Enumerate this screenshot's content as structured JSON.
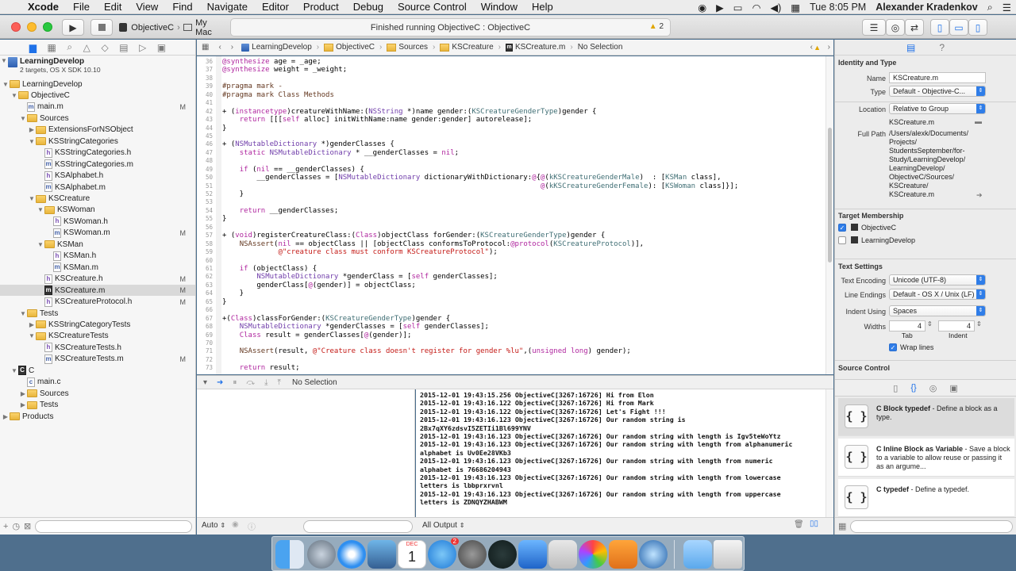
{
  "menubar": {
    "app": "Xcode",
    "items": [
      "File",
      "Edit",
      "View",
      "Find",
      "Navigate",
      "Editor",
      "Product",
      "Debug",
      "Source Control",
      "Window",
      "Help"
    ],
    "clock": "Tue 8:05 PM",
    "user": "Alexander Kradenkov"
  },
  "toolbar": {
    "scheme": "ObjectiveC",
    "destination": "My Mac",
    "activity": "Finished running ObjectiveC : ObjectiveC",
    "warnings": "2"
  },
  "navigator": {
    "project_name": "LearningDevelop",
    "project_sub": "2 targets, OS X SDK 10.10",
    "rows": [
      {
        "label": "LearningDevelop",
        "kind": "folder",
        "open": true,
        "indent": 1,
        "flag": ""
      },
      {
        "label": "ObjectiveC",
        "kind": "folder",
        "open": true,
        "indent": 2,
        "flag": ""
      },
      {
        "label": "main.m",
        "kind": "m",
        "open": null,
        "indent": 3,
        "flag": "M"
      },
      {
        "label": "Sources",
        "kind": "folder",
        "open": true,
        "indent": 3,
        "flag": ""
      },
      {
        "label": "ExtensionsForNSObject",
        "kind": "folder",
        "open": false,
        "indent": 4,
        "flag": ""
      },
      {
        "label": "KSStringCategories",
        "kind": "folder",
        "open": true,
        "indent": 4,
        "flag": ""
      },
      {
        "label": "KSStringCategories.h",
        "kind": "h",
        "open": null,
        "indent": 5,
        "flag": ""
      },
      {
        "label": "KSStringCategories.m",
        "kind": "m",
        "open": null,
        "indent": 5,
        "flag": ""
      },
      {
        "label": "KSAlphabet.h",
        "kind": "h",
        "open": null,
        "indent": 5,
        "flag": ""
      },
      {
        "label": "KSAlphabet.m",
        "kind": "m",
        "open": null,
        "indent": 5,
        "flag": ""
      },
      {
        "label": "KSCreature",
        "kind": "folder",
        "open": true,
        "indent": 4,
        "flag": ""
      },
      {
        "label": "KSWoman",
        "kind": "folder",
        "open": true,
        "indent": 5,
        "flag": ""
      },
      {
        "label": "KSWoman.h",
        "kind": "h",
        "open": null,
        "indent": 6,
        "flag": ""
      },
      {
        "label": "KSWoman.m",
        "kind": "m",
        "open": null,
        "indent": 6,
        "flag": "M"
      },
      {
        "label": "KSMan",
        "kind": "folder",
        "open": true,
        "indent": 5,
        "flag": ""
      },
      {
        "label": "KSMan.h",
        "kind": "h",
        "open": null,
        "indent": 6,
        "flag": ""
      },
      {
        "label": "KSMan.m",
        "kind": "m",
        "open": null,
        "indent": 6,
        "flag": ""
      },
      {
        "label": "KSCreature.h",
        "kind": "h",
        "open": null,
        "indent": 5,
        "flag": "M"
      },
      {
        "label": "KSCreature.m",
        "kind": "mdark",
        "open": null,
        "indent": 5,
        "flag": "M",
        "selected": true
      },
      {
        "label": "KSCreatureProtocol.h",
        "kind": "h",
        "open": null,
        "indent": 5,
        "flag": "M"
      },
      {
        "label": "Tests",
        "kind": "folder",
        "open": true,
        "indent": 3,
        "flag": ""
      },
      {
        "label": "KSStringCategoryTests",
        "kind": "folder",
        "open": false,
        "indent": 4,
        "flag": ""
      },
      {
        "label": "KSCreatureTests",
        "kind": "folder",
        "open": true,
        "indent": 4,
        "flag": ""
      },
      {
        "label": "KSCreatureTests.h",
        "kind": "h",
        "open": null,
        "indent": 5,
        "flag": ""
      },
      {
        "label": "KSCreatureTests.m",
        "kind": "m",
        "open": null,
        "indent": 5,
        "flag": "M"
      },
      {
        "label": "C",
        "kind": "cfolder",
        "open": true,
        "indent": 2,
        "flag": ""
      },
      {
        "label": "main.c",
        "kind": "c",
        "open": null,
        "indent": 3,
        "flag": ""
      },
      {
        "label": "Sources",
        "kind": "folder",
        "open": false,
        "indent": 3,
        "flag": ""
      },
      {
        "label": "Tests",
        "kind": "folder",
        "open": false,
        "indent": 3,
        "flag": ""
      },
      {
        "label": "Products",
        "kind": "folder",
        "open": false,
        "indent": 1,
        "flag": ""
      }
    ]
  },
  "jumpbar": {
    "crumbs": [
      "LearningDevelop",
      "ObjectiveC",
      "Sources",
      "KSCreature",
      "KSCreature.m",
      "No Selection"
    ]
  },
  "editor": {
    "lines": [
      {
        "n": "36",
        "h": "<span class=\"kw\">@synthesize</span> age = _age;"
      },
      {
        "n": "37",
        "h": "<span class=\"kw\">@synthesize</span> weight = _weight;"
      },
      {
        "n": "38",
        "h": ""
      },
      {
        "n": "39",
        "h": "<span class=\"mac\">#pragma mark -</span>"
      },
      {
        "n": "40",
        "h": "<span class=\"mac\">#pragma mark Class Methods</span>"
      },
      {
        "n": "41",
        "h": ""
      },
      {
        "n": "42",
        "h": "+ (<span class=\"kw\">instancetype</span>)creatureWithName:(<span class=\"ty\">NSString</span> *)name gender:(<span class=\"pr\">KSCreatureGenderType</span>)gender {"
      },
      {
        "n": "43",
        "h": "    <span class=\"kw\">return</span> [[[<span class=\"kw\">self</span> alloc] initWithName:name gender:gender] autorelease];"
      },
      {
        "n": "44",
        "h": "}"
      },
      {
        "n": "45",
        "h": ""
      },
      {
        "n": "46",
        "h": "+ (<span class=\"ty\">NSMutableDictionary</span> *)genderClasses {"
      },
      {
        "n": "47",
        "h": "    <span class=\"kw\">static</span> <span class=\"ty\">NSMutableDictionary</span> * __genderClasses = <span class=\"kw\">nil</span>;"
      },
      {
        "n": "48",
        "h": ""
      },
      {
        "n": "49",
        "h": "    <span class=\"kw\">if</span> (<span class=\"kw\">nil</span> == __genderClasses) {"
      },
      {
        "n": "50",
        "h": "        __genderClasses = [<span class=\"ty\">NSMutableDictionary</span> dictionaryWithDictionary:<span class=\"kw\">@</span>{<span class=\"kw\">@</span>(<span class=\"pr\">kKSCreatureGenderMale</span>)  : [<span class=\"pr\">KSMan</span> class],"
      },
      {
        "n": "51",
        "h": "                                                                          <span class=\"kw\">@</span>(<span class=\"pr\">kKSCreatureGenderFemale</span>): [<span class=\"pr\">KSWoman</span> class]}];"
      },
      {
        "n": "52",
        "h": "    }"
      },
      {
        "n": "53",
        "h": ""
      },
      {
        "n": "54",
        "h": "    <span class=\"kw\">return</span> __genderClasses;"
      },
      {
        "n": "55",
        "h": "}"
      },
      {
        "n": "56",
        "h": ""
      },
      {
        "n": "57",
        "h": "+ (<span class=\"kw\">void</span>)registerCreatureClass:(<span class=\"kw\">Class</span>)objectClass forGender:(<span class=\"pr\">KSCreatureGenderType</span>)gender {"
      },
      {
        "n": "58",
        "h": "    <span class=\"mac\">NSAssert</span>(<span class=\"kw\">nil</span> == objectClass || [objectClass conformsToProtocol:<span class=\"kw\">@protocol</span>(<span class=\"pr\">KSCreatureProtocol</span>)],"
      },
      {
        "n": "59",
        "h": "             <span class=\"st\">@\"creature class must conform KSCreatureProtocol\"</span>);"
      },
      {
        "n": "60",
        "h": ""
      },
      {
        "n": "61",
        "h": "    <span class=\"kw\">if</span> (objectClass) {"
      },
      {
        "n": "62",
        "h": "        <span class=\"ty\">NSMutableDictionary</span> *genderClass = [<span class=\"kw\">self</span> genderClasses];"
      },
      {
        "n": "63",
        "h": "        genderClass[<span class=\"kw\">@</span>(gender)] = objectClass;"
      },
      {
        "n": "64",
        "h": "    }"
      },
      {
        "n": "65",
        "h": "}"
      },
      {
        "n": "66",
        "h": ""
      },
      {
        "n": "67",
        "h": "+(<span class=\"kw\">Class</span>)classForGender:(<span class=\"pr\">KSCreatureGenderType</span>)gender {"
      },
      {
        "n": "68",
        "h": "    <span class=\"ty\">NSMutableDictionary</span> *genderClasses = [<span class=\"kw\">self</span> genderClasses];"
      },
      {
        "n": "69",
        "h": "    <span class=\"kw\">Class</span> result = genderClasses[<span class=\"kw\">@</span>(gender)];"
      },
      {
        "n": "70",
        "h": ""
      },
      {
        "n": "71",
        "h": "    <span class=\"mac\">NSAssert</span>(result, <span class=\"st\">@\"Creature class doesn't register for gender %lu\"</span>,(<span class=\"kw\">unsigned long</span>) gender);"
      },
      {
        "n": "72",
        "h": ""
      },
      {
        "n": "73",
        "h": "    <span class=\"kw\">return</span> result;"
      }
    ]
  },
  "debug": {
    "selection": "No Selection",
    "scope": "Auto",
    "output": "All Output",
    "console": [
      "2015-12-01 19:43:15.256 ObjectiveC[3267:16726] Hi from Elon",
      "2015-12-01 19:43:16.122 ObjectiveC[3267:16726] Hi from Mark",
      "2015-12-01 19:43:16.122 ObjectiveC[3267:16726] Let's Fight !!!",
      "2015-12-01 19:43:16.123 ObjectiveC[3267:16726] Our random string is",
      "2Bx7qXY6zdsvI5ZETIi1Bl699YNV",
      "2015-12-01 19:43:16.123 ObjectiveC[3267:16726] Our random string with length is Igv5teWoYtz",
      "2015-12-01 19:43:16.123 ObjectiveC[3267:16726] Our random string with length from alphanumeric",
      "alphabet is Uv0Ee28VKb3",
      "2015-12-01 19:43:16.123 ObjectiveC[3267:16726] Our random string with length from numeric",
      "alphabet is 76686204943",
      "2015-12-01 19:43:16.123 ObjectiveC[3267:16726] Our random string with length from lowercase",
      "letters is lbbprxrvnl",
      "2015-12-01 19:43:16.123 ObjectiveC[3267:16726] Our random string with length from uppercase",
      "letters is ZDNQYZHABWM"
    ]
  },
  "inspector": {
    "identity_title": "Identity and Type",
    "name_label": "Name",
    "name_value": "KSCreature.m",
    "type_label": "Type",
    "type_value": "Default - Objective-C...",
    "location_label": "Location",
    "location_value": "Relative to Group",
    "location_file": "KSCreature.m",
    "fullpath_label": "Full Path",
    "fullpath_lines": [
      "/Users/alexk/Documents/",
      "Projects/",
      "StudentsSeptember/for-",
      "Study/LearningDevelop/",
      "LearningDevelop/",
      "ObjectiveC/Sources/",
      "KSCreature/",
      "KSCreature.m"
    ],
    "target_title": "Target Membership",
    "targets": [
      {
        "label": "ObjectiveC",
        "checked": true
      },
      {
        "label": "LearningDevelop",
        "checked": false
      }
    ],
    "text_title": "Text Settings",
    "encoding_label": "Text Encoding",
    "encoding_value": "Unicode (UTF-8)",
    "endings_label": "Line Endings",
    "endings_value": "Default - OS X / Unix (LF)",
    "indent_label": "Indent Using",
    "indent_value": "Spaces",
    "widths_label": "Widths",
    "tab_value": "4",
    "indent_width_value": "4",
    "tab_label": "Tab",
    "indent_sub_label": "Indent",
    "wrap_label": "Wrap lines",
    "source_title": "Source Control",
    "library": [
      {
        "title": "C Block typedef",
        "desc": " - Define a block as a type."
      },
      {
        "title": "C Inline Block as Variable",
        "desc": " - Save a block to a variable to allow reuse or passing it as an argume..."
      },
      {
        "title": "C typedef",
        "desc": " - Define a typedef."
      }
    ]
  },
  "dock": {
    "calendar_month": "DEC",
    "calendar_day": "1",
    "appstore_badge": "2"
  }
}
